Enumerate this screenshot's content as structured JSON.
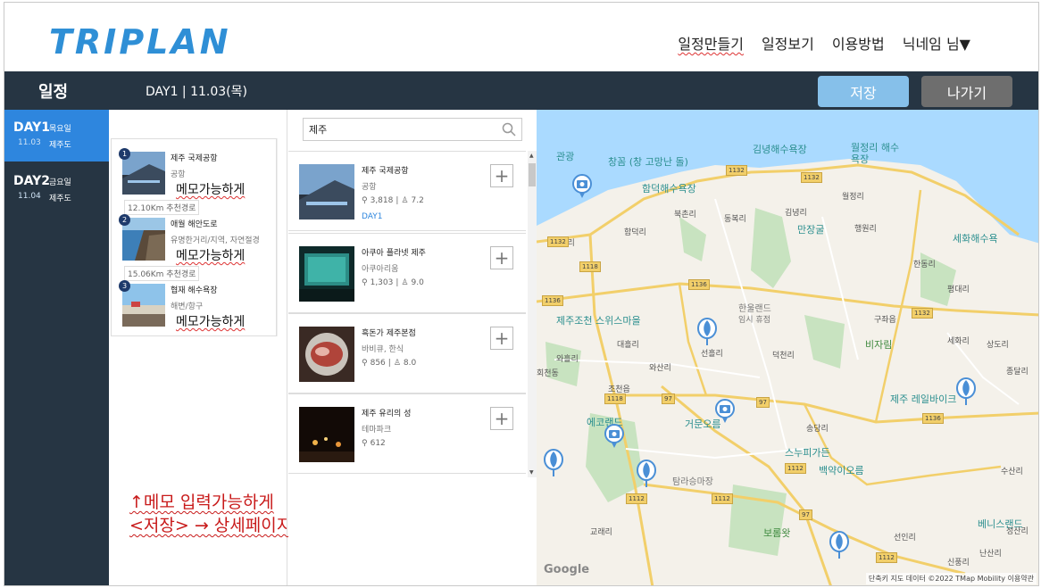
{
  "header": {
    "logo": "TRIPLAN",
    "nav": [
      "일정만들기",
      "일정보기",
      "이용방법",
      "닉네임 님▼"
    ]
  },
  "toolbar": {
    "title": "일정",
    "day_info": "DAY1 | 11.03(목)",
    "save_label": "저장",
    "exit_label": "나가기"
  },
  "days": [
    {
      "label": "DAY1",
      "weekday": "목요일",
      "date": "11.03",
      "region": "제주도",
      "active": true
    },
    {
      "label": "DAY2",
      "weekday": "금요일",
      "date": "11.04",
      "region": "제주도",
      "active": false
    }
  ],
  "schedule": [
    {
      "num": "1",
      "name": "제주 국제공항",
      "category": "공항",
      "memo": "메모가능하게"
    },
    {
      "num": "2",
      "name": "애월 해안도로",
      "category": "유명한거리/지역, 자연절경",
      "memo": "메모가능하게"
    },
    {
      "num": "3",
      "name": "협재 해수욕장",
      "category": "해변/항구",
      "memo": "메모가능하게"
    }
  ],
  "routes": [
    "12.10Km 추천경로",
    "15.06Km 추천경로"
  ],
  "note": {
    "line1": "↑메모 입력가능하게",
    "line2": "<저장> → 상세페이지 보여짐"
  },
  "search": {
    "value": "제주",
    "results": [
      {
        "name": "제주 국제공항",
        "category": "공항",
        "clips": "3,818",
        "likes": "7.2",
        "day": "DAY1"
      },
      {
        "name": "아쿠아 플라넷 제주",
        "category": "아쿠아리움",
        "clips": "1,303",
        "likes": "9.0",
        "day": ""
      },
      {
        "name": "흑돈가 제주본점",
        "category": "바비큐, 한식",
        "clips": "856",
        "likes": "8.0",
        "day": ""
      },
      {
        "name": "제주 유리의 성",
        "category": "테마파크",
        "clips": "612",
        "likes": "",
        "day": ""
      }
    ],
    "add_label": "+"
  },
  "map": {
    "poi_labels": [
      "관광",
      "창꼼 (창 고망난 돌)",
      "함덕해수욕장",
      "김녕해수욕장",
      "월정리 해수욕장",
      "만장굴",
      "세화해수욕",
      "제주조천 스위스마을",
      "한울랜드",
      "임시 휴점",
      "비자림",
      "제주 레일바이크",
      "에코랜드",
      "거문오름",
      "스누피가든",
      "백약이오름",
      "탐라승마장",
      "보롬왓",
      "베니스랜드"
    ],
    "place_labels": [
      "북촌리",
      "동복리",
      "김녕리",
      "월정리",
      "조천리",
      "함덕리",
      "행원리",
      "한동리",
      "평대리",
      "대흘리",
      "선흘리",
      "덕천리",
      "구좌읍",
      "세화리",
      "상도리",
      "종달리",
      "와흘리",
      "와산리",
      "조천읍",
      "회천동",
      "송당리",
      "수산리",
      "교래리",
      "선인리",
      "난산리",
      "신풍리",
      "성산리"
    ],
    "road_numbers": [
      "1132",
      "1132",
      "1132",
      "1118",
      "1136",
      "1136",
      "1132",
      "1118",
      "97",
      "97",
      "1112",
      "1136",
      "1112",
      "1112",
      "97",
      "1112"
    ],
    "google_label": "Google",
    "attribution": "단축키   지도 데이터 ©2022 TMap Mobility   이용약관"
  },
  "colors": {
    "toolbar_bg": "#263543",
    "day_active": "#2e86de",
    "save_button": "#86c0ea",
    "exit_button": "#6e6e6e",
    "logo": "#2f8fd6",
    "note": "#c81a1a"
  }
}
